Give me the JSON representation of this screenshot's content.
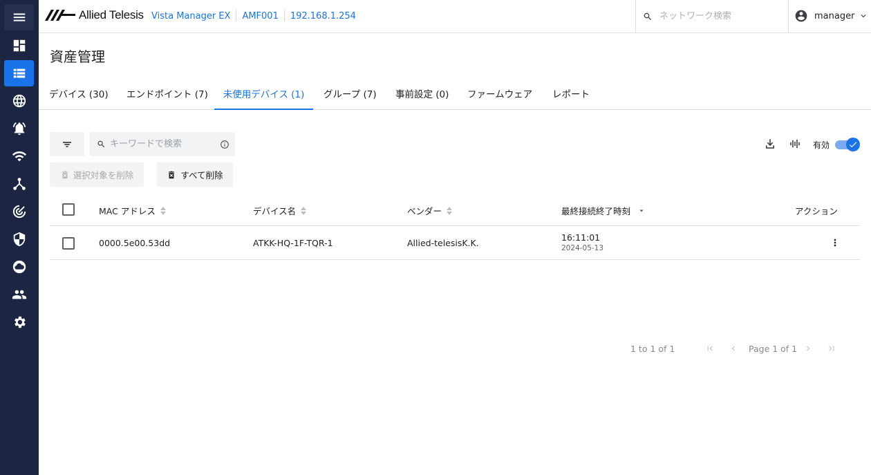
{
  "header": {
    "brand": "Allied Telesis",
    "breadcrumbs": [
      "Vista Manager EX",
      "AMF001",
      "192.168.1.254"
    ],
    "search_placeholder": "ネットワーク検索",
    "user": "manager"
  },
  "sidebar": {
    "items": [
      "menu-icon",
      "dashboard-icon",
      "list-icon",
      "globe-icon",
      "alarm-icon",
      "wifi-icon",
      "topology-icon",
      "radar-icon",
      "shield-icon",
      "cloud-icon",
      "people-icon",
      "gear-icon"
    ],
    "active_index": 2,
    "accent": "#1a73e8",
    "background": "#1c2541"
  },
  "page_title": "資産管理",
  "tabs": [
    {
      "label": "デバイス (30)"
    },
    {
      "label": "エンドポイント (7)"
    },
    {
      "label": "未使用デバイス (1)",
      "active": true
    },
    {
      "label": "グループ (7)"
    },
    {
      "label": "事前設定 (0)"
    },
    {
      "label": "ファームウェア"
    },
    {
      "label": "レポート"
    }
  ],
  "toolbar": {
    "keyword_placeholder": "キーワードで検索",
    "delete_selected_label": "選択対象を削除",
    "delete_all_label": "すべて削除",
    "toggle_label": "有効",
    "toggle_on": true
  },
  "table": {
    "columns": [
      "MAC アドレス",
      "デバイス名",
      "ベンダー",
      "最終接続終了時刻",
      "アクション"
    ],
    "sorted_column": "最終接続終了時刻",
    "rows": [
      {
        "mac": "0000.5e00.53dd",
        "device_name": "ATKK-HQ-1F-TQR-1",
        "vendor": "Allied-telesisK.K.",
        "time": "16:11:01",
        "date": "2024-05-13"
      }
    ]
  },
  "pagination": {
    "range": "1 to 1 of 1",
    "page": "Page 1 of 1"
  }
}
